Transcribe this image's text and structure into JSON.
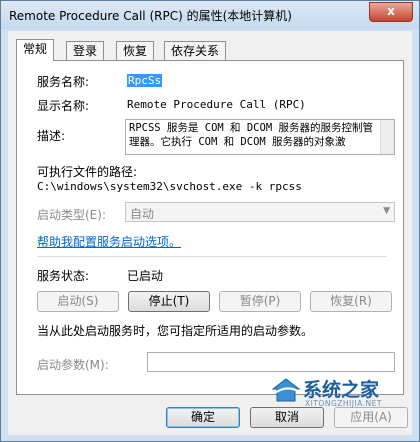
{
  "window": {
    "title": "Remote Procedure Call (RPC) 的属性(本地计算机)",
    "close": "x"
  },
  "tabs": [
    "常规",
    "登录",
    "恢复",
    "依存关系"
  ],
  "general": {
    "service_name_label": "服务名称:",
    "service_name": "RpcSs",
    "display_name_label": "显示名称:",
    "display_name": "Remote Procedure Call (RPC)",
    "description_label": "描述:",
    "description": "RPCSS 服务是 COM 和 DCOM 服务器的服务控制管理器。它执行 COM 和 DCOM 服务器的对象激",
    "path_label": "可执行文件的路径:",
    "path": "C:\\windows\\system32\\svchost.exe -k rpcss",
    "startup_type_label": "启动类型(E):",
    "startup_type": "自动",
    "help_link": "帮助我配置服务启动选项。",
    "status_label": "服务状态:",
    "status": "已启动",
    "buttons": {
      "start": "启动(S)",
      "stop": "停止(T)",
      "pause": "暂停(P)",
      "resume": "恢复(R)"
    },
    "hint": "当从此处启动服务时，您可指定所适用的启动参数。",
    "params_label": "启动参数(M):",
    "params_value": ""
  },
  "footer": {
    "ok": "确定",
    "cancel": "取消",
    "apply": "应用(A)"
  },
  "watermark": {
    "text": "系统之家",
    "url": "XITONGZHIJIA.NET"
  }
}
